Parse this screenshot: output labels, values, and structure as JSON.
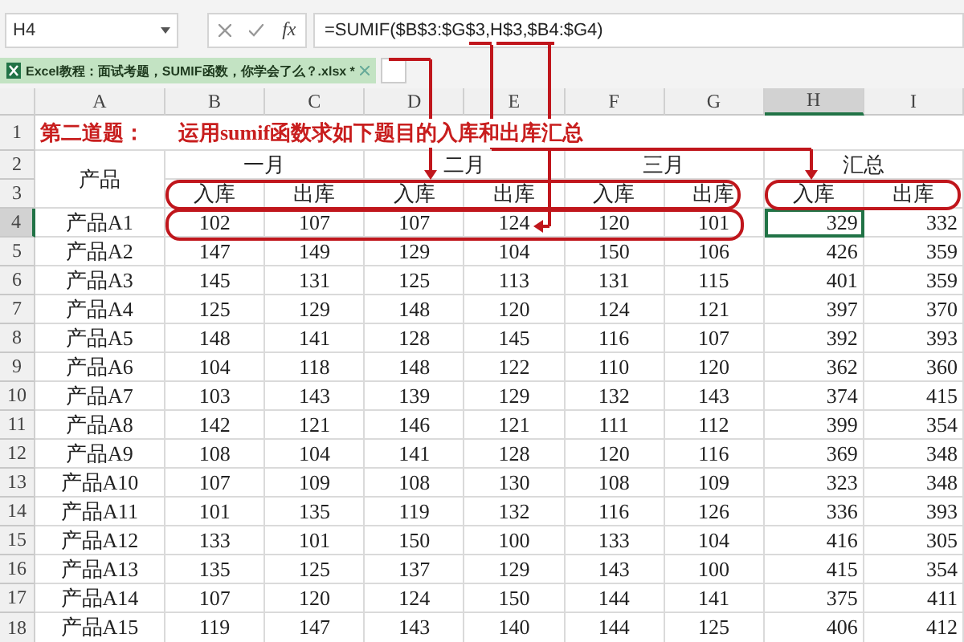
{
  "name_box": "H4",
  "formula_bar": {
    "function_label": "fx",
    "formula": "=SUMIF($B$3:$G$3,H$3,$B4:$G4)"
  },
  "workbook_tab": {
    "title": "Excel教程：面试考题，SUMIF函数，你学会了么？.xlsx *",
    "selected": true
  },
  "columns": [
    {
      "label": "A",
      "selected": false
    },
    {
      "label": "B",
      "selected": false
    },
    {
      "label": "C",
      "selected": false
    },
    {
      "label": "D",
      "selected": false
    },
    {
      "label": "E",
      "selected": false
    },
    {
      "label": "F",
      "selected": false
    },
    {
      "label": "G",
      "selected": false
    },
    {
      "label": "H",
      "selected": true
    },
    {
      "label": "I",
      "selected": false
    }
  ],
  "title_row": {
    "number": "1",
    "label": "第二道题：",
    "text": "运用sumif函数求如下题目的入库和出库汇总"
  },
  "header_rows": {
    "numbers": [
      "2",
      "3"
    ],
    "product": "产品",
    "groups": [
      "一月",
      "二月",
      "三月",
      "汇总"
    ],
    "subheaders": [
      "入库",
      "出库",
      "入库",
      "出库",
      "入库",
      "出库",
      "入库",
      "出库"
    ]
  },
  "data_rows": [
    {
      "number": "4",
      "selected": true,
      "product": "产品A1",
      "values": [
        "102",
        "107",
        "107",
        "124",
        "120",
        "101",
        "329",
        "332"
      ]
    },
    {
      "number": "5",
      "selected": false,
      "product": "产品A2",
      "values": [
        "147",
        "149",
        "129",
        "104",
        "150",
        "106",
        "426",
        "359"
      ]
    },
    {
      "number": "6",
      "selected": false,
      "product": "产品A3",
      "values": [
        "145",
        "131",
        "125",
        "113",
        "131",
        "115",
        "401",
        "359"
      ]
    },
    {
      "number": "7",
      "selected": false,
      "product": "产品A4",
      "values": [
        "125",
        "129",
        "148",
        "120",
        "124",
        "121",
        "397",
        "370"
      ]
    },
    {
      "number": "8",
      "selected": false,
      "product": "产品A5",
      "values": [
        "148",
        "141",
        "128",
        "145",
        "116",
        "107",
        "392",
        "393"
      ]
    },
    {
      "number": "9",
      "selected": false,
      "product": "产品A6",
      "values": [
        "104",
        "118",
        "148",
        "122",
        "110",
        "120",
        "362",
        "360"
      ]
    },
    {
      "number": "10",
      "selected": false,
      "product": "产品A7",
      "values": [
        "103",
        "143",
        "139",
        "129",
        "132",
        "143",
        "374",
        "415"
      ]
    },
    {
      "number": "11",
      "selected": false,
      "product": "产品A8",
      "values": [
        "142",
        "121",
        "146",
        "121",
        "111",
        "112",
        "399",
        "354"
      ]
    },
    {
      "number": "12",
      "selected": false,
      "product": "产品A9",
      "values": [
        "108",
        "104",
        "141",
        "128",
        "120",
        "116",
        "369",
        "348"
      ]
    },
    {
      "number": "13",
      "selected": false,
      "product": "产品A10",
      "values": [
        "107",
        "109",
        "108",
        "130",
        "108",
        "109",
        "323",
        "348"
      ]
    },
    {
      "number": "14",
      "selected": false,
      "product": "产品A11",
      "values": [
        "101",
        "135",
        "119",
        "132",
        "116",
        "126",
        "336",
        "393"
      ]
    },
    {
      "number": "15",
      "selected": false,
      "product": "产品A12",
      "values": [
        "133",
        "101",
        "150",
        "100",
        "133",
        "104",
        "416",
        "305"
      ]
    },
    {
      "number": "16",
      "selected": false,
      "product": "产品A13",
      "values": [
        "135",
        "125",
        "137",
        "129",
        "143",
        "100",
        "415",
        "354"
      ]
    },
    {
      "number": "17",
      "selected": false,
      "product": "产品A14",
      "values": [
        "107",
        "120",
        "124",
        "150",
        "144",
        "141",
        "375",
        "411"
      ]
    },
    {
      "number": "18",
      "selected": false,
      "product": "产品A15",
      "values": [
        "119",
        "147",
        "143",
        "140",
        "144",
        "125",
        "406",
        "412"
      ]
    }
  ]
}
